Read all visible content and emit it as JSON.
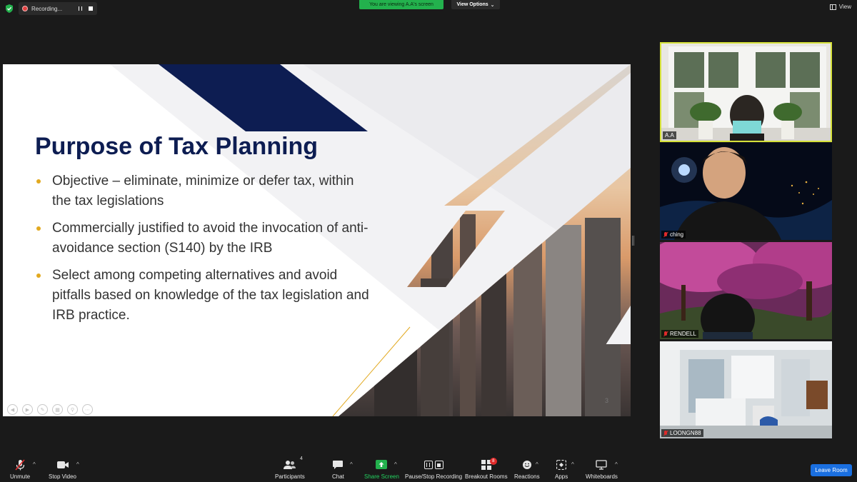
{
  "recording": {
    "label": "Recording..."
  },
  "banner": {
    "viewing_text": "You are viewing A.A's screen",
    "view_options": "View Options",
    "view": "View"
  },
  "slide": {
    "title": "Purpose of Tax Planning",
    "bullets": [
      "Objective – eliminate, minimize or defer tax, within the tax legislations",
      "Commercially justified to avoid the invocation of anti-avoidance section (S140) by the IRB",
      "Select among competing alternatives and avoid pitfalls based on knowledge of the tax legislation and IRB practice."
    ],
    "page_number": "3",
    "colors": {
      "title": "#0d1d52",
      "bullet": "#e2a920",
      "accent_bar": "#0d1d52"
    }
  },
  "participants": [
    {
      "name": "A.A",
      "active_speaker": true,
      "muted": false
    },
    {
      "name": "ching",
      "muted": true
    },
    {
      "name": "RENDELL",
      "muted": true
    },
    {
      "name": "LOONGN88",
      "muted": true
    }
  ],
  "toolbar": {
    "unmute": "Unmute",
    "stop_video": "Stop Video",
    "participants": "Participants",
    "participants_count": "4",
    "chat": "Chat",
    "share_screen": "Share Screen",
    "pause_stop_recording": "Pause/Stop Recording",
    "breakout_rooms": "Breakout Rooms",
    "breakout_badge": "8",
    "reactions": "Reactions",
    "apps": "Apps",
    "whiteboards": "Whiteboards",
    "leave_room": "Leave Room"
  },
  "colors": {
    "share_green": "#23b14d",
    "leave_blue": "#1a6fe0",
    "speaker_border": "#d6e23a"
  }
}
